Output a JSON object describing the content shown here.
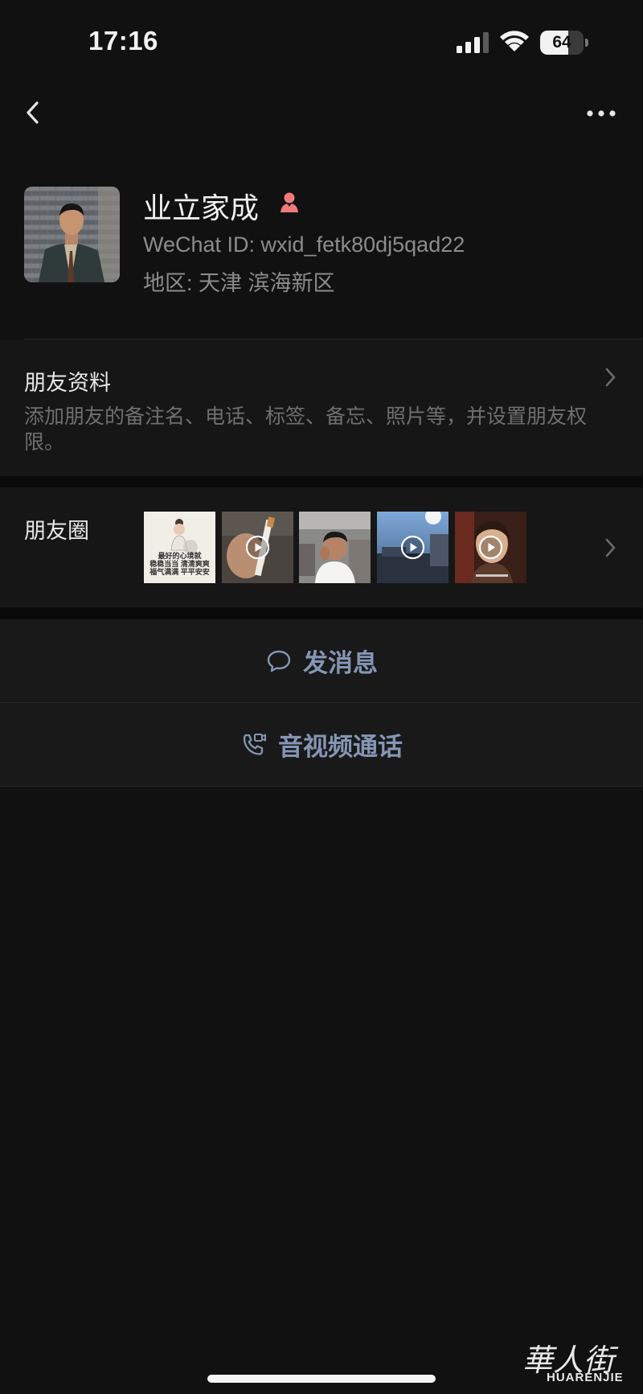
{
  "status_bar": {
    "time": "17:16",
    "battery": "64",
    "battery_level": 0.64
  },
  "nav": {
    "back_icon": "chevron-left-icon",
    "more_icon": "more-dots-icon"
  },
  "profile": {
    "name": "业立家成",
    "gender_icon": "female-icon",
    "gender_color": "#f07a7a",
    "wechat_id": "WeChat ID: wxid_fetk80dj5qad22",
    "region": "地区: 天津 滨海新区"
  },
  "friend_info": {
    "title": "朋友资料",
    "description": "添加朋友的备注名、电话、标签、备忘、照片等，并设置朋友权限。"
  },
  "moments": {
    "label": "朋友圈",
    "thumbnails": [
      {
        "kind": "image",
        "caption_line1": "最好的心境就",
        "caption_line2": "稳稳当当 清清爽爽",
        "caption_line3": "福气满满 平平安安"
      },
      {
        "kind": "video"
      },
      {
        "kind": "image"
      },
      {
        "kind": "video"
      },
      {
        "kind": "video"
      }
    ]
  },
  "actions": {
    "message_label": "发消息",
    "message_icon": "chat-bubble-icon",
    "call_label": "音视频通话",
    "call_icon": "phone-video-icon",
    "accent_color": "#8595b4"
  },
  "watermark": {
    "logo": "華人街",
    "text": "HUARENJIE"
  }
}
